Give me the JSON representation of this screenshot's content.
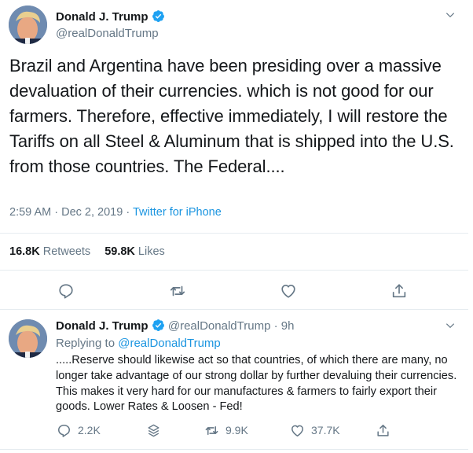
{
  "main_tweet": {
    "author_name": "Donald J. Trump",
    "handle": "@realDonaldTrump",
    "text": "Brazil and Argentina have been presiding over a massive devaluation of their currencies. which is not good for our farmers. Therefore, effective immediately, I will restore the Tariffs on all Steel & Aluminum that is shipped into the U.S. from those countries. The Federal....",
    "time": "2:59 AM",
    "separator": "·",
    "date": "Dec 2, 2019",
    "source": "Twitter for iPhone",
    "retweets_count": "16.8K",
    "retweets_label": "Retweets",
    "likes_count": "59.8K",
    "likes_label": "Likes",
    "icons": [
      "reply-icon",
      "retweet-icon",
      "like-icon",
      "share-icon"
    ]
  },
  "reply_tweet": {
    "author_name": "Donald J. Trump",
    "handle": "@realDonaldTrump",
    "separator": "·",
    "age": "9h",
    "replying_prefix": "Replying to",
    "replying_to": "@realDonaldTrump",
    "text": ".....Reserve should likewise act so that countries, of which there are many, no longer take advantage of our strong dollar by further devaluing their currencies. This makes it very hard for our manufactures & farmers to fairly export their goods. Lower Rates & Loosen - Fed!",
    "reply_count": "2.2K",
    "retweet_count": "9.9K",
    "like_count": "37.7K"
  },
  "colors": {
    "accent": "#1b95e0",
    "verified": "#1da1f2",
    "muted": "#657786",
    "text": "#14171a",
    "divider": "#e6ecf0"
  }
}
